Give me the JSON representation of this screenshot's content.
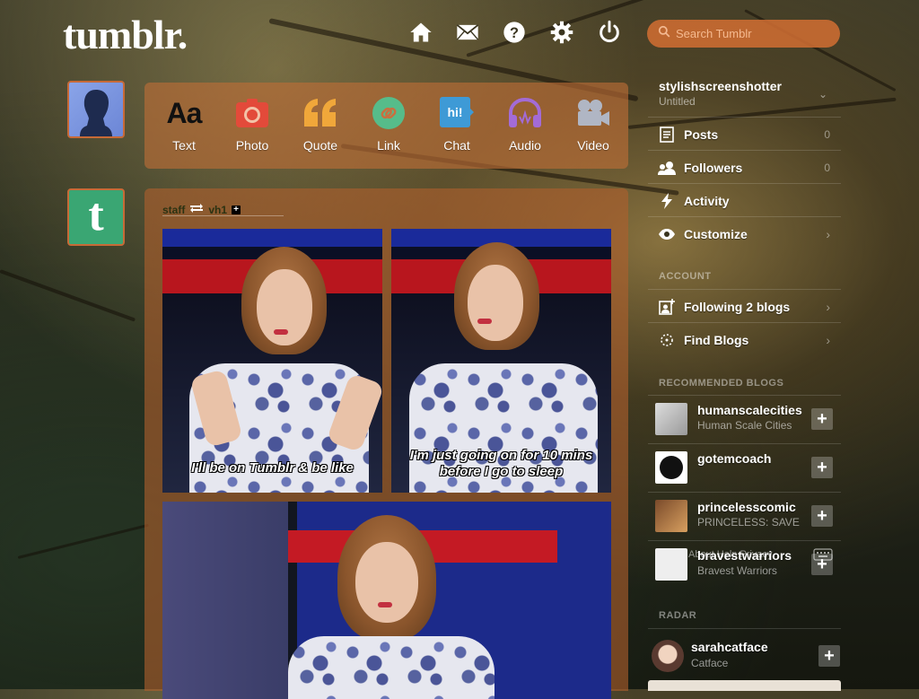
{
  "header": {
    "logo": "tumblr.",
    "search_placeholder": "Search Tumblr",
    "icons": [
      "home-icon",
      "mail-icon",
      "help-icon",
      "settings-icon",
      "power-icon"
    ]
  },
  "post_types": [
    {
      "label": "Text",
      "icon": "text-icon"
    },
    {
      "label": "Photo",
      "icon": "photo-icon"
    },
    {
      "label": "Quote",
      "icon": "quote-icon"
    },
    {
      "label": "Link",
      "icon": "link-icon"
    },
    {
      "label": "Chat",
      "icon": "chat-icon",
      "icon_text": "hi!"
    },
    {
      "label": "Audio",
      "icon": "audio-icon"
    },
    {
      "label": "Video",
      "icon": "video-icon"
    }
  ],
  "post": {
    "reblogged_by": "staff",
    "source": "vh1",
    "captions": [
      "I'll be on Tumblr & be like",
      "I'm just going on for 10 mins before I go to sleep"
    ]
  },
  "sidebar": {
    "blog_name": "stylishscreenshotter",
    "blog_title": "Untitled",
    "items": [
      {
        "label": "Posts",
        "count": "0",
        "icon": "posts-icon"
      },
      {
        "label": "Followers",
        "count": "0",
        "icon": "followers-icon"
      },
      {
        "label": "Activity",
        "icon": "activity-icon"
      },
      {
        "label": "Customize",
        "chevron": "›",
        "icon": "eye-icon"
      }
    ],
    "account_heading": "ACCOUNT",
    "account_items": [
      {
        "label": "Following 2 blogs",
        "chevron": "›",
        "icon": "following-icon"
      },
      {
        "label": "Find Blogs",
        "chevron": "›",
        "icon": "find-blogs-icon"
      }
    ],
    "recommended_heading": "RECOMMENDED BLOGS",
    "recommended": [
      {
        "name": "humanscalecities",
        "subtitle": "Human Scale Cities",
        "follow": "+"
      },
      {
        "name": "gotemcoach",
        "subtitle": "",
        "follow": "+"
      },
      {
        "name": "princelesscomic",
        "subtitle": "PRINCELESS: SAVE",
        "follow": "+"
      },
      {
        "name": "bravestwarriors",
        "subtitle": "Bravest Warriors",
        "follow": "+"
      }
    ],
    "footer_links": "About  Help  Privacy",
    "radar_heading": "RADAR",
    "radar": {
      "name": "sarahcatface",
      "subtitle": "Catface",
      "follow": "+"
    }
  },
  "colors": {
    "accent": "#c76a37",
    "tumblr_green": "#3aa673",
    "photo": "#e34a3a",
    "quote": "#f0a73a",
    "link": "#56bc8a",
    "chat": "#3e9ad6",
    "audio": "#a36bd6",
    "video": "#b0b6c4"
  }
}
